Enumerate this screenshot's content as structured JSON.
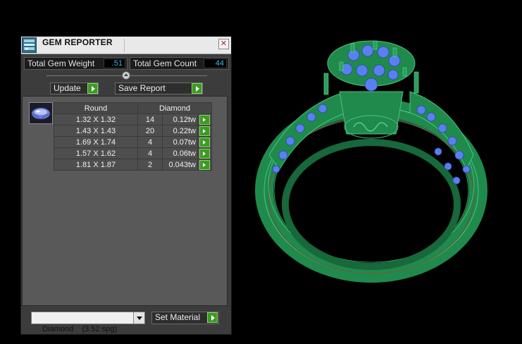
{
  "panel": {
    "title": "GEM REPORTER",
    "close_glyph": "✕",
    "total_weight_label": "Total Gem Weight",
    "total_weight_value": ".51",
    "total_count_label": "Total Gem Count",
    "total_count_value": "44",
    "update_label": "Update",
    "save_report_label": "Save Report",
    "table": {
      "shape_header": "Round",
      "material_header": "Diamond",
      "rows": [
        {
          "size": "1.32 X 1.32",
          "count": "14",
          "weight": "0.12tw"
        },
        {
          "size": "1.43 X 1.43",
          "count": "20",
          "weight": "0.22tw"
        },
        {
          "size": "1.69 X 1.74",
          "count": "4",
          "weight": "0.07tw"
        },
        {
          "size": "1.57 X 1.62",
          "count": "4",
          "weight": "0.06tw"
        },
        {
          "size": "1.81 X 1.87",
          "count": "2",
          "weight": "0.043tw"
        }
      ]
    },
    "material_select": "Diamond    (3.52 spg)",
    "set_material_label": "Set Material"
  },
  "colors": {
    "panel_bg": "#3c3c3c",
    "value_text": "#3db8e8",
    "go_button": "#3c9a24",
    "ring_metal": "#1f8a4c",
    "gems": "#5a7ff0"
  },
  "icons": {
    "app": "gem-reporter-app-icon",
    "close": "close-icon",
    "go": "play-arrow-icon",
    "collapse": "collapse-arrow-icon",
    "dropdown": "chevron-down-icon"
  }
}
